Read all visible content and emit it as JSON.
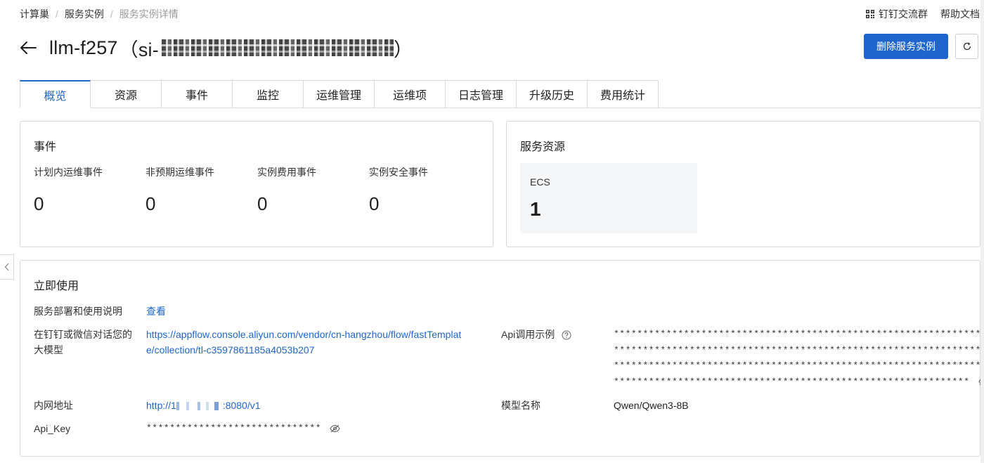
{
  "breadcrumb": {
    "level1": "计算巢",
    "level2": "服务实例",
    "current": "服务实例详情",
    "separator": "/"
  },
  "topbar": {
    "dingtalk_group": "钉钉交流群",
    "help_docs": "帮助文档"
  },
  "header": {
    "title_prefix": "llm-f257",
    "open_paren": "（si-",
    "close_paren": "）"
  },
  "actions": {
    "delete_button": "删除服务实例"
  },
  "tabs": [
    "概览",
    "资源",
    "事件",
    "监控",
    "运维管理",
    "运维项",
    "日志管理",
    "升级历史",
    "费用统计"
  ],
  "active_tab": "概览",
  "events_card": {
    "title": "事件",
    "stats": [
      {
        "label": "计划内运维事件",
        "value": "0"
      },
      {
        "label": "非预期运维事件",
        "value": "0"
      },
      {
        "label": "实例费用事件",
        "value": "0"
      },
      {
        "label": "实例安全事件",
        "value": "0"
      }
    ]
  },
  "resources_card": {
    "title": "服务资源",
    "tile_label": "ECS",
    "tile_value": "1"
  },
  "usage_card": {
    "title": "立即使用",
    "deploy_doc": {
      "label": "服务部署和使用说明",
      "value": "查看"
    },
    "chat": {
      "label_line1": "在钉钉或微信对话您的",
      "label_line2": "大模型",
      "url_line1": "https://appflow.console.aliyun.com/vendor/cn-hangzhou/flow/fastTemplat",
      "url_line2": "e/collection/tl-c3597861185a4053b207"
    },
    "api_example": {
      "label": "Api调用示例",
      "line1": "******************************************************************",
      "line2": "******************************************************************",
      "line3": "******************************************************************",
      "line4": "*************************************************************"
    },
    "internal_address": {
      "label": "内网地址",
      "prefix": "http://1",
      "suffix": ":8080/v1"
    },
    "model_name": {
      "label": "模型名称",
      "value": "Qwen/Qwen3-8B"
    },
    "api_key": {
      "label": "Api_Key",
      "value": "******************************"
    }
  },
  "colors": {
    "primary": "#1e66cd",
    "border": "#d9d9d9",
    "tile_bg": "#f5f6f7"
  }
}
